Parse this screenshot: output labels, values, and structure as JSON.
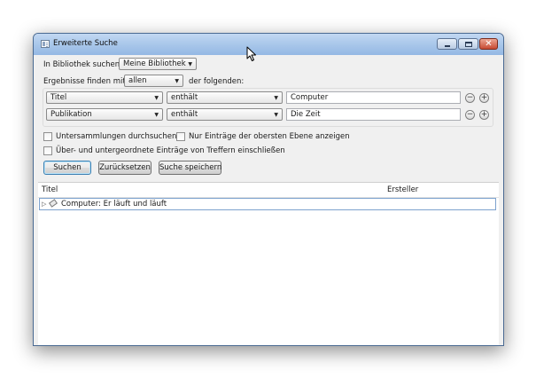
{
  "window": {
    "title": "Erweiterte Suche",
    "close_glyph": "✕"
  },
  "library": {
    "label": "In Bibliothek suchen:",
    "selected": "Meine Bibliothek"
  },
  "match": {
    "prefix": "Ergebnisse finden mit",
    "selected": "allen",
    "suffix": "der folgenden:"
  },
  "conditions": [
    {
      "field": "Titel",
      "operator": "enthält",
      "value": "Computer"
    },
    {
      "field": "Publikation",
      "operator": "enthält",
      "value": "Die Zeit"
    }
  ],
  "options": {
    "subcollections": "Untersammlungen durchsuchen",
    "top_level_only": "Nur Einträge der obersten Ebene anzeigen",
    "include_parent_child": "Über- und untergeordnete Einträge von Treffern einschließen"
  },
  "buttons": {
    "search": "Suchen",
    "reset": "Zurücksetzen",
    "save_search": "Suche speichern"
  },
  "results": {
    "columns": [
      "Titel",
      "Ersteller"
    ],
    "rows": [
      {
        "title": "Computer: Er läuft und läuft",
        "creator": ""
      }
    ]
  },
  "glyphs": {
    "dropdown_arrow": "▼",
    "expand": "▷",
    "remove": "−",
    "add": "+"
  },
  "icons": [
    "app-icon",
    "minimize-icon",
    "maximize-icon",
    "close-icon",
    "dropdown-arrow-icon",
    "remove-condition-icon",
    "add-condition-icon",
    "expand-arrow-icon",
    "tag-icon",
    "mouse-cursor-icon"
  ]
}
